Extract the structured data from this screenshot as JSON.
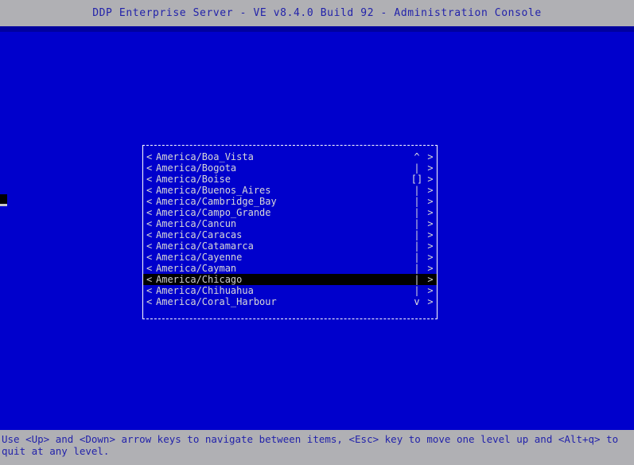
{
  "titlebar": {
    "title": "DDP Enterprise Server - VE v8.4.0 Build 92 - Administration Console"
  },
  "dialog": {
    "left_marker": "<",
    "right_marker": ">",
    "scroll_up_glyph": "^",
    "scroll_down_glyph": "v",
    "scroll_track_glyph": "|",
    "scroll_thumb_glyph": "[]",
    "selected_index": 11,
    "items": [
      {
        "label": "America/Boa_Vista",
        "scroll": "^",
        "selected": false
      },
      {
        "label": "America/Bogota",
        "scroll": "|",
        "selected": false
      },
      {
        "label": "America/Boise",
        "scroll": "[]",
        "selected": false
      },
      {
        "label": "America/Buenos_Aires",
        "scroll": "|",
        "selected": false
      },
      {
        "label": "America/Cambridge_Bay",
        "scroll": "|",
        "selected": false
      },
      {
        "label": "America/Campo_Grande",
        "scroll": "|",
        "selected": false
      },
      {
        "label": "America/Cancun",
        "scroll": "|",
        "selected": false
      },
      {
        "label": "America/Caracas",
        "scroll": "|",
        "selected": false
      },
      {
        "label": "America/Catamarca",
        "scroll": "|",
        "selected": false
      },
      {
        "label": "America/Cayenne",
        "scroll": "|",
        "selected": false
      },
      {
        "label": "America/Cayman",
        "scroll": "|",
        "selected": false
      },
      {
        "label": "America/Chicago",
        "scroll": "|",
        "selected": true
      },
      {
        "label": "America/Chihuahua",
        "scroll": "|",
        "selected": false
      },
      {
        "label": "America/Coral_Harbour",
        "scroll": "v",
        "selected": false
      }
    ]
  },
  "statusbar": {
    "help_text": "Use <Up> and <Down> arrow keys to navigate between items, <Esc> key to move one level up and <Alt+q> to quit at any level."
  },
  "colors": {
    "screen_background": "#0000cc",
    "chrome_background": "#b0b0b4",
    "chrome_text": "#2222aa",
    "menu_text": "#d8d8d8",
    "selection_background": "#000000",
    "border": "#ffffff",
    "top_strip": "#00009e"
  }
}
